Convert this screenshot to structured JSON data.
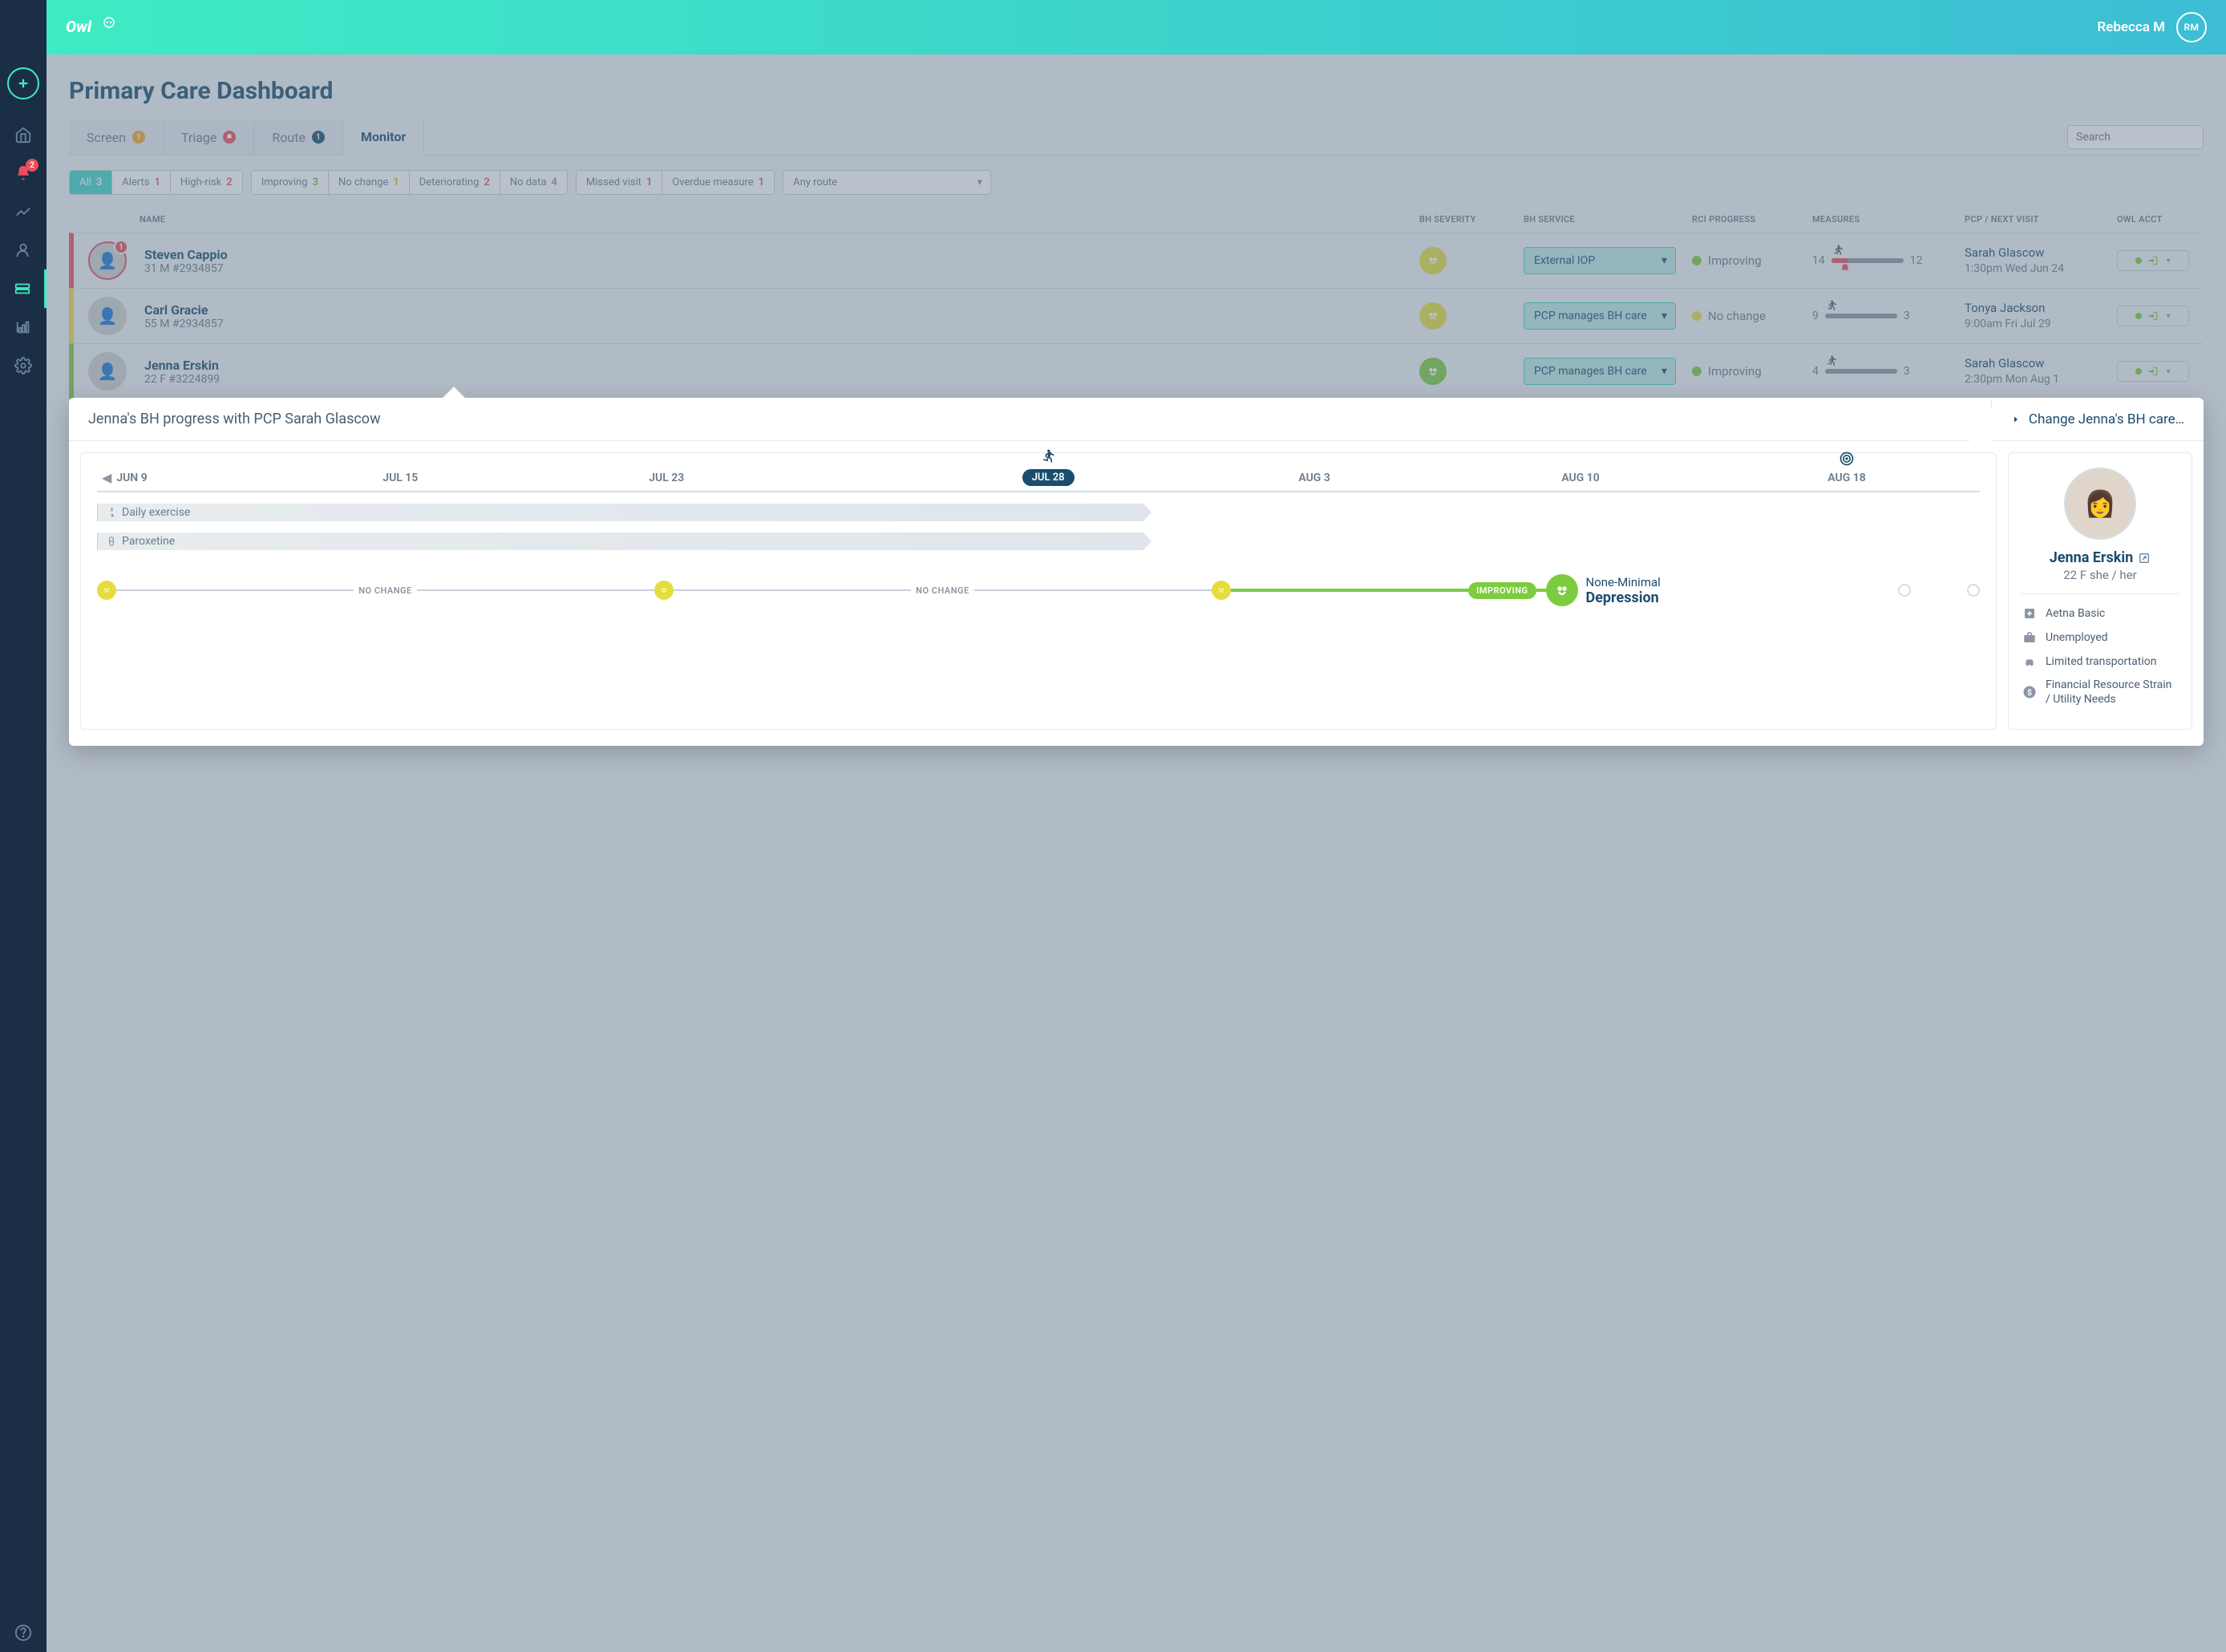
{
  "user": {
    "name": "Rebecca M",
    "initials": "RM"
  },
  "sidebar": {
    "alert_count": "2"
  },
  "page_title": "Primary Care Dashboard",
  "tabs": [
    {
      "label": "Screen",
      "badge": "1",
      "badge_color": "orange"
    },
    {
      "label": "Triage",
      "badge": "1",
      "badge_color": "red",
      "badge_icon": "bell"
    },
    {
      "label": "Route",
      "badge": "1",
      "badge_color": "navy"
    },
    {
      "label": "Monitor",
      "active": true
    }
  ],
  "search": {
    "placeholder": "Search"
  },
  "filters": {
    "group1": [
      {
        "label": "All",
        "count": "3",
        "active": true
      },
      {
        "label": "Alerts",
        "count": "1",
        "count_class": "red"
      },
      {
        "label": "High-risk",
        "count": "2",
        "count_class": "red"
      }
    ],
    "group2": [
      {
        "label": "Improving",
        "count": "3",
        "count_class": "green"
      },
      {
        "label": "No change",
        "count": "1",
        "count_class": "orange"
      },
      {
        "label": "Deteriorating",
        "count": "2",
        "count_class": "red"
      },
      {
        "label": "No data",
        "count": "4",
        "count_class": "grey"
      }
    ],
    "group3": [
      {
        "label": "Missed visit",
        "count": "1",
        "count_class": "red"
      },
      {
        "label": "Overdue measure",
        "count": "1",
        "count_class": "red"
      }
    ],
    "route_select": "Any route"
  },
  "table": {
    "headers": {
      "name": "NAME",
      "severity": "BH SEVERITY",
      "service": "BH SERVICE",
      "rci": "RCI PROGRESS",
      "measures": "MEASURES",
      "pcp": "PCP / NEXT VISIT",
      "owl": "OWL ACCT"
    },
    "rows": [
      {
        "border": "red",
        "avatar_notif": "1",
        "avatar_ring": true,
        "name": "Steven Cappio",
        "sub": "31 M  #2934857",
        "severity_class": "face-yellow",
        "service": "External IOP",
        "rci_label": "Improving",
        "rci_dot": "dot-green",
        "meas_start": "14",
        "meas_end": "12",
        "meas_bell": true,
        "pcp_name": "Sarah Glascow",
        "pcp_time": "1:30pm Wed Jun 24"
      },
      {
        "border": "yellow",
        "name": "Carl Gracie",
        "sub": "55 M  #2934857",
        "severity_class": "face-yellow",
        "service": "PCP manages BH care",
        "rci_label": "No change",
        "rci_dot": "dot-yellow",
        "meas_start": "9",
        "meas_end": "3",
        "pcp_name": "Tonya Jackson",
        "pcp_time": "9:00am Fri Jul 29"
      },
      {
        "border": "green",
        "name": "Jenna Erskin",
        "sub": "22 F  #3224899",
        "severity_class": "face-green",
        "service": "PCP manages BH care",
        "rci_label": "Improving",
        "rci_dot": "dot-green",
        "meas_start": "4",
        "meas_end": "3",
        "pcp_name": "Sarah Glascow",
        "pcp_time": "2:30pm Mon Aug 1"
      }
    ]
  },
  "detail": {
    "title": "Jenna's BH progress with PCP Sarah Glascow",
    "change_label": "Change Jenna's BH care…",
    "dates": [
      "JUN 9",
      "JUL 15",
      "JUL 23",
      "JUL 28",
      "AUG 3",
      "AUG 10",
      "AUG 18"
    ],
    "current_date_index": 3,
    "activities": [
      {
        "icon": "exercise",
        "label": "Daily exercise"
      },
      {
        "icon": "pill",
        "label": "Paroxetine"
      }
    ],
    "progress": {
      "segments": [
        {
          "label": "NO CHANGE"
        },
        {
          "label": "NO CHANGE"
        },
        {
          "pill": "IMPROVING"
        }
      ],
      "status_line1": "None-Minimal",
      "status_line2": "Depression"
    },
    "patient": {
      "name": "Jenna Erskin",
      "sub": "22 F  she / her",
      "items": [
        {
          "icon": "hospital",
          "label": "Aetna Basic"
        },
        {
          "icon": "briefcase",
          "label": "Unemployed"
        },
        {
          "icon": "car",
          "label": "Limited transportation"
        },
        {
          "icon": "dollar",
          "label": "Financial Resource Strain / Utility Needs"
        }
      ]
    }
  }
}
